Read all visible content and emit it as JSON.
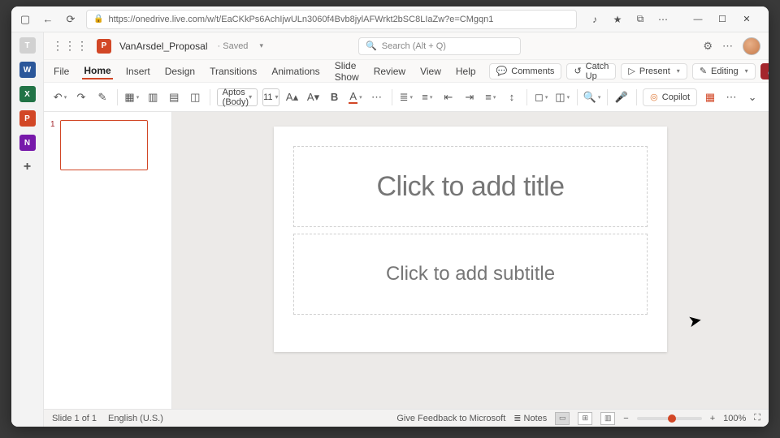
{
  "browser": {
    "url": "https://onedrive.live.com/w/t/EaCKkPs6AchIjwULn3060f4Bvb8jylAFWrkt2bSC8LIaZw?e=CMgqn1",
    "fav_icon": "★",
    "ext_icon": "⧉",
    "more_icon": "⋯"
  },
  "left_rail": {
    "items": [
      "T",
      "W",
      "X",
      "P",
      "N",
      "+"
    ]
  },
  "title": {
    "app_letter": "P",
    "doc_name": "VanArsdel_Proposal",
    "status": "· Saved",
    "search_placeholder": "Search (Alt + Q)",
    "settings_icon": "⚙",
    "more_icon": "⋯"
  },
  "ribbon": {
    "tabs": [
      "File",
      "Home",
      "Insert",
      "Design",
      "Transitions",
      "Animations",
      "Slide Show",
      "Review",
      "View",
      "Help"
    ],
    "active_tab": "Home",
    "right": {
      "comments": "Comments",
      "catchup": "Catch Up",
      "present": "Present",
      "editing": "Editing",
      "share": "Share"
    }
  },
  "toolbar": {
    "undo": "↶",
    "redo": "↷",
    "paint": "✎",
    "new_slide": "▦",
    "layout": "▥",
    "section": "▤",
    "reset": "◫",
    "font_name": "Aptos (Body)",
    "font_size": "11",
    "inc_label": "A▴",
    "dec_label": "A▾",
    "bold": "B",
    "font_color": "A",
    "bullets": "≣",
    "numbers": "≡",
    "indent_dec": "⇤",
    "indent_inc": "⇥",
    "align": "≡",
    "line_sp": "↕",
    "shapes": "◻",
    "arrange": "◫",
    "find": "🔍",
    "dictate": "🎤",
    "copilot": "Copilot",
    "designer": "▦",
    "more": "⋯"
  },
  "slide": {
    "thumb_num": "1",
    "title_ph": "Click to add title",
    "subtitle_ph": "Click to add subtitle"
  },
  "status": {
    "slide_of": "Slide 1 of 1",
    "lang": "English (U.S.)",
    "feedback": "Give Feedback to Microsoft",
    "notes": "Notes",
    "zoom_pct": "100%",
    "fit": "⛶"
  }
}
